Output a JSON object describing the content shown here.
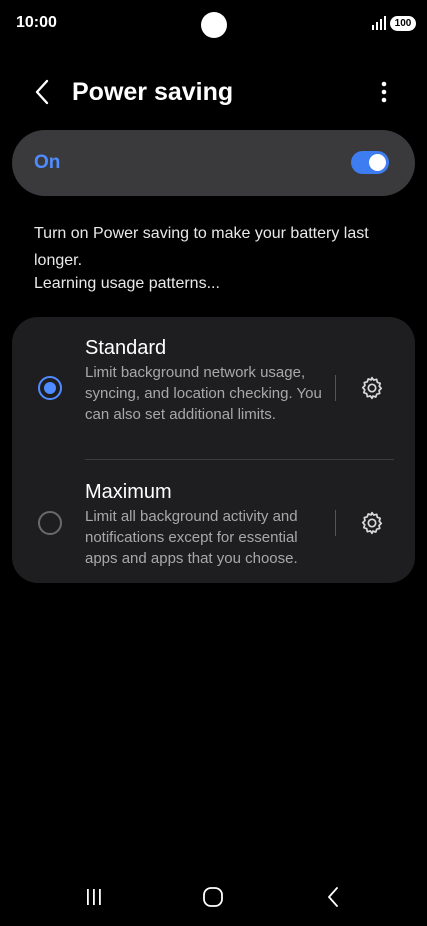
{
  "status_bar": {
    "time": "10:00",
    "battery": "100"
  },
  "header": {
    "title": "Power saving",
    "back_icon": "chevron-left-icon",
    "more_icon": "more-vertical-icon"
  },
  "master_switch": {
    "label": "On",
    "enabled": true,
    "accent": "#4f8cff"
  },
  "description": "Turn on Power saving to make your battery last longer.",
  "status_text": "Learning usage patterns...",
  "modes": [
    {
      "title": "Standard",
      "description": "Limit background network usage, syncing, and location checking. You can also set additional limits.",
      "selected": true
    },
    {
      "title": "Maximum",
      "description": "Limit all background activity and notifications except for essential apps and apps that you choose.",
      "selected": false
    }
  ],
  "nav": {
    "recents_icon": "recents-icon",
    "home_icon": "home-icon",
    "back_icon": "back-icon"
  }
}
